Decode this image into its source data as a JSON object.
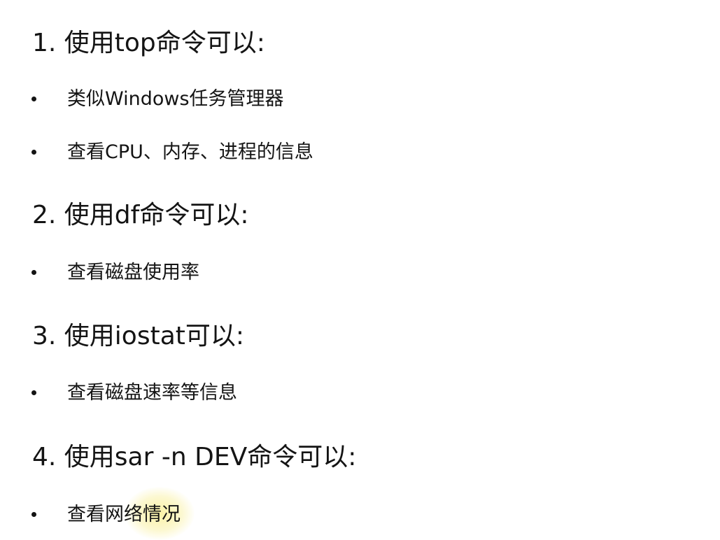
{
  "sections": [
    {
      "heading": "1. 使用top命令可以:",
      "items": [
        "类似Windows任务管理器",
        "查看CPU、内存、进程的信息"
      ]
    },
    {
      "heading": "2. 使用df命令可以:",
      "items": [
        "查看磁盘使用率"
      ]
    },
    {
      "heading": "3. 使用iostat可以:",
      "items": [
        "查看磁盘速率等信息"
      ]
    },
    {
      "heading": "4. 使用sar -n DEV命令可以:",
      "items": [
        "查看网络情况"
      ]
    }
  ],
  "highlight_color": "#f7ec9a"
}
